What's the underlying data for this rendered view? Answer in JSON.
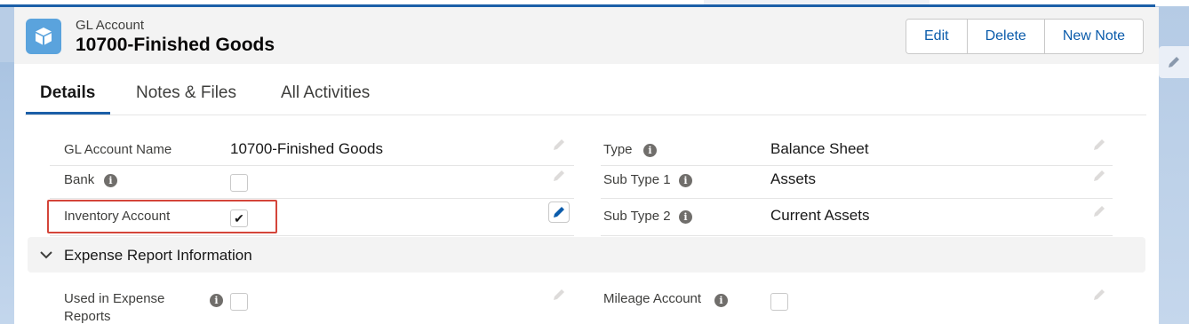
{
  "header": {
    "object_type": "GL Account",
    "record_title": "10700-Finished Goods",
    "icon": "cube-icon",
    "buttons": [
      "Edit",
      "Delete",
      "New Note"
    ]
  },
  "tabs": [
    {
      "label": "Details",
      "active": true
    },
    {
      "label": "Notes & Files",
      "active": false
    },
    {
      "label": "All Activities",
      "active": false
    }
  ],
  "fields_left": [
    {
      "label": "GL Account Name",
      "value": "10700-Finished Goods",
      "type": "text"
    },
    {
      "label": "Bank",
      "value": "",
      "type": "checkbox",
      "checked": false,
      "info": true
    },
    {
      "label": "Inventory Account",
      "value": "",
      "type": "checkbox",
      "checked": true,
      "highlighted": true
    }
  ],
  "fields_right": [
    {
      "label": "Type",
      "value": "Balance Sheet",
      "info": true
    },
    {
      "label": "Sub Type 1",
      "value": "Assets",
      "info": true
    },
    {
      "label": "Sub Type 2",
      "value": "Current Assets",
      "info": true
    }
  ],
  "section": {
    "title": "Expense Report Information",
    "expanded": true,
    "fields": [
      {
        "label_line1": "Used in Expense",
        "label_line2": "Reports",
        "type": "checkbox",
        "checked": false,
        "info": true
      },
      {
        "label": "Mileage Account",
        "type": "checkbox",
        "checked": false,
        "info": true
      }
    ]
  },
  "glyphs": {
    "check": "✔",
    "info": "i"
  },
  "colors": {
    "accent": "#1b5fa8",
    "link": "#0b5cab",
    "highlight": "#d4453a",
    "icon_bg": "#5aa3dd"
  }
}
